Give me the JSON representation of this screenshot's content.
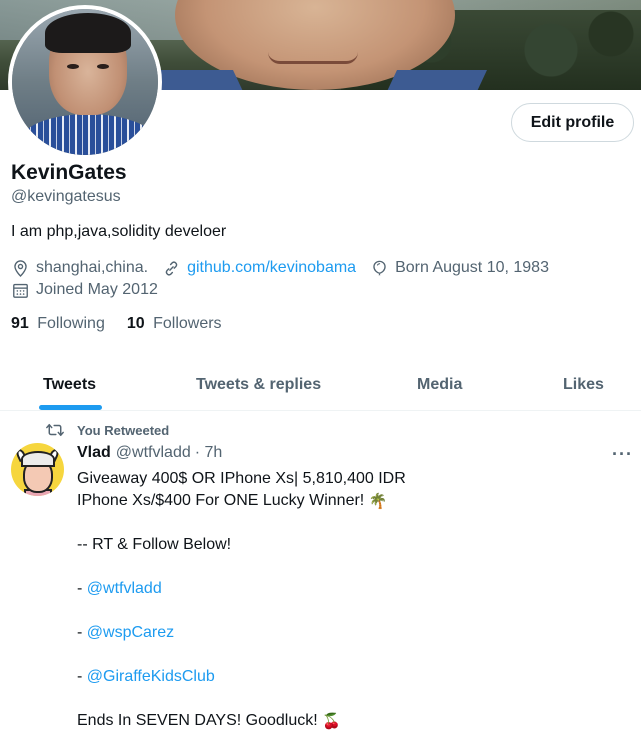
{
  "profile": {
    "name": "KevinGates",
    "handle": "@kevingatesus",
    "bio": "I am php,java,solidity develoer",
    "location": "shanghai,china.",
    "website": "github.com/kevinobama",
    "birthday": "Born August 10, 1983",
    "joined": "Joined May 2012",
    "following_count": "91",
    "following_label": "Following",
    "followers_count": "10",
    "followers_label": "Followers",
    "edit_button": "Edit profile"
  },
  "tabs": [
    {
      "label": "Tweets",
      "active": true
    },
    {
      "label": "Tweets & replies",
      "active": false
    },
    {
      "label": "Media",
      "active": false
    },
    {
      "label": "Likes",
      "active": false
    }
  ],
  "tweet": {
    "retweet_label": "You Retweeted",
    "author_name": "Vlad",
    "author_handle": "@wtfvladd",
    "time": "· 7h",
    "more": "···",
    "lines": {
      "l1": "Giveaway 400$ OR IPhone Xs| 5,810,400 IDR",
      "l2": "IPhone Xs/$400 For ONE Lucky Winner!",
      "l2_emoji": "🌴",
      "l3": "-- RT & Follow Below!",
      "dash": "- ",
      "m1": "@wtfvladd",
      "m2": "@wspCarez",
      "m3": "@GiraffeKidsClub",
      "l7": "Ends In SEVEN DAYS! Goodluck!",
      "l7_emoji": "🍒"
    }
  },
  "colors": {
    "accent": "#1d9bf0",
    "text_primary": "#0f1419",
    "text_secondary": "#536471",
    "border": "#cfd9de"
  },
  "icons": {
    "location": "map-pin-icon",
    "website": "link-icon",
    "birthday": "balloon-icon",
    "joined": "calendar-icon",
    "retweet": "retweet-icon",
    "more": "more-horizontal-icon"
  }
}
